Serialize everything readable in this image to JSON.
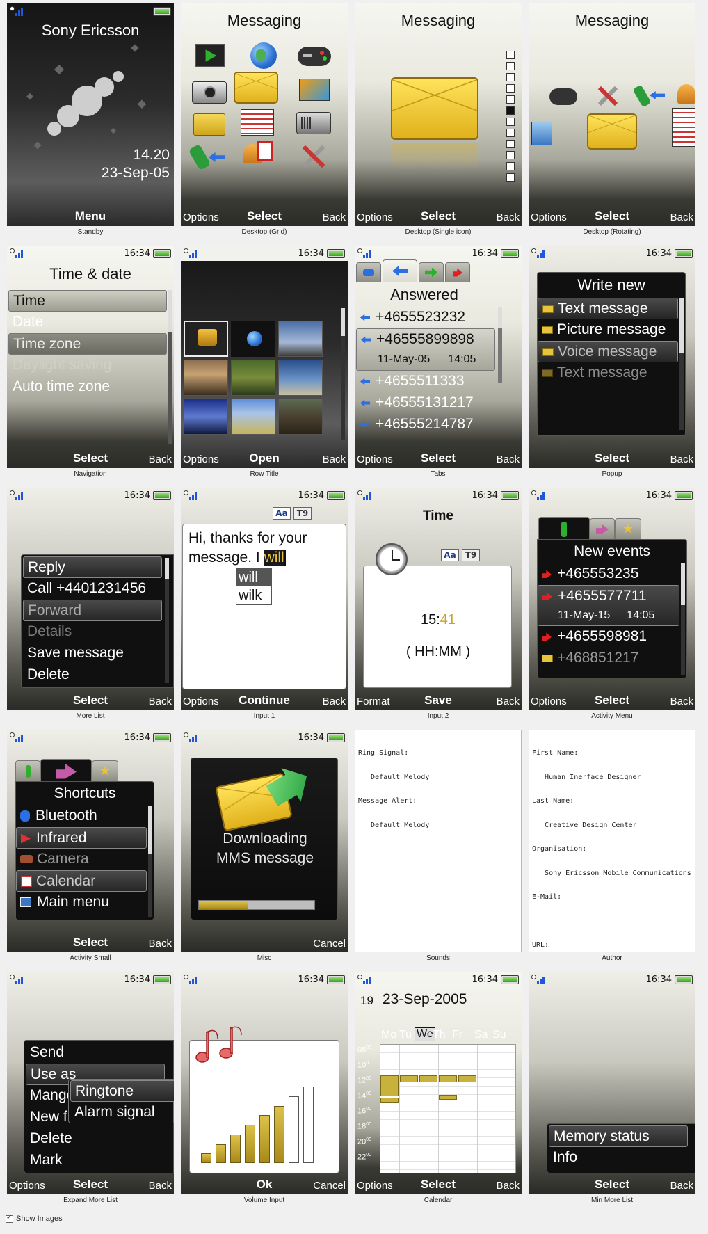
{
  "captions": [
    "Standby",
    "Desktop (Grid)",
    "Desktop (Single icon)",
    "Desktop (Rotating)",
    "Navigation",
    "Row Title",
    "Tabs",
    "Popup",
    "More List",
    "Input 1",
    "Input 2",
    "Activity Menu",
    "Activity Small",
    "Misc",
    "Sounds",
    "Author",
    "Expand More List",
    "Volume Input",
    "Calendar",
    "Min More List"
  ],
  "clock": "16:34",
  "softkeys": {
    "options": "Options",
    "select": "Select",
    "back": "Back",
    "menu": "Menu",
    "open": "Open",
    "continue": "Continue",
    "format": "Format",
    "save": "Save",
    "cancel": "Cancel",
    "ok": "Ok"
  },
  "standby": {
    "brand": "Sony Ericsson",
    "time": "14.20",
    "date": "23-Sep-05"
  },
  "desktop": {
    "title": "Messaging"
  },
  "navigation": {
    "title": "Time & date",
    "items": [
      "Time",
      "Date",
      "Time zone",
      "Daylight saving",
      "Auto time zone"
    ]
  },
  "tabs": {
    "title": "Answered",
    "numbers": [
      "+4655523232",
      "+46555899898",
      "+4655511333",
      "+46555131217",
      "+46555214787"
    ],
    "detail_date": "11-May-05",
    "detail_time": "14:05"
  },
  "popup": {
    "title": "Write new",
    "items": [
      "Text message",
      "Picture message",
      "Voice message",
      "Text message"
    ]
  },
  "more_list": {
    "items": [
      "Reply",
      "Call +4401231456",
      "Forward",
      "Details",
      "Save message",
      "Delete"
    ]
  },
  "input1": {
    "text_before": "Hi, thanks for your message. I ",
    "highlight": "will",
    "suggestions": [
      "will",
      "wilk"
    ],
    "mode_abc": "Aa",
    "mode_t9": "T9"
  },
  "input2": {
    "title": "Time",
    "hours": "15:",
    "minutes": "41",
    "format": "( HH:MM )",
    "mode_abc": "Aa",
    "mode_t9": "T9"
  },
  "activity_menu": {
    "title": "New events",
    "numbers": [
      "+465553235",
      "+4655577711",
      "+4655598981",
      "+468851217"
    ],
    "detail_date": "11-May-15",
    "detail_time": "14:05"
  },
  "activity_small": {
    "title": "Shortcuts",
    "items": [
      "Bluetooth",
      "Infrared",
      "Camera",
      "Calendar",
      "Main menu"
    ]
  },
  "misc": {
    "line1": "Downloading",
    "line2": "MMS message",
    "progress": 0.42
  },
  "sounds": {
    "lines": [
      "Ring Signal:",
      "   Default Melody",
      "Message Alert:",
      "   Default Melody"
    ]
  },
  "author": {
    "lines": [
      "First Name:",
      "   Human Inerface Designer",
      "Last Name:",
      "   Creative Design Center",
      "Organisation:",
      "   Sony Ericsson Mobile Communications",
      "E-Mail:",
      "",
      "URL:"
    ]
  },
  "expand_more": {
    "items": [
      "Send",
      "Use as",
      "Mange",
      "New f",
      "Delete",
      "Mark"
    ],
    "sub": [
      "Ringtone",
      "Alarm signal"
    ]
  },
  "volume": {
    "levels": [
      1,
      2,
      3,
      4,
      5,
      6,
      7,
      8
    ],
    "filled": 6
  },
  "calendar": {
    "week": "19",
    "date": "23-Sep-2005",
    "days": [
      "Mo",
      "Tu",
      "We",
      "Th",
      "Fr",
      "Sa",
      "Su"
    ],
    "hours": [
      "08",
      "10",
      "12",
      "14",
      "16",
      "18",
      "20",
      "22"
    ],
    "minutes": "00"
  },
  "min_more": {
    "items": [
      "Memory status",
      "Info"
    ]
  },
  "footer": {
    "label": "Show Images"
  }
}
